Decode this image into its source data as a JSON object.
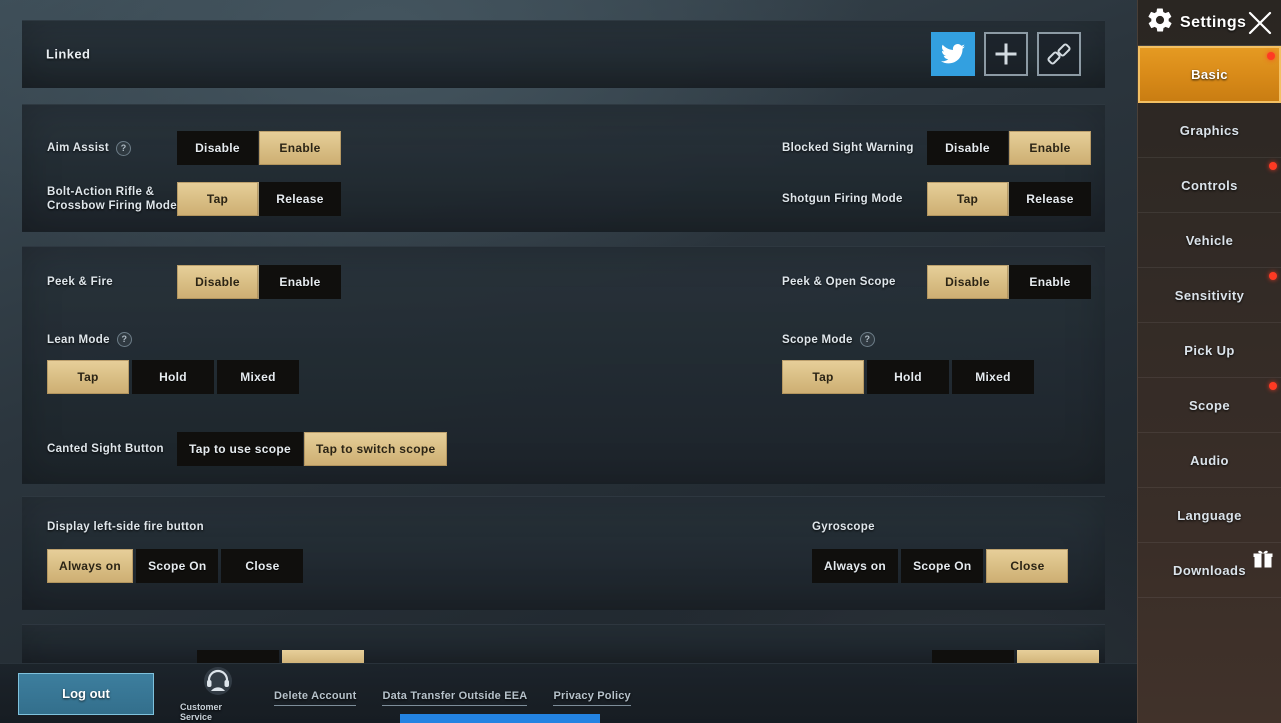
{
  "sidebar": {
    "title": "Settings",
    "gear_icon": "gear-icon",
    "close_icon": "close-icon",
    "items": [
      {
        "label": "Basic",
        "active": true,
        "badge": true,
        "gift": false
      },
      {
        "label": "Graphics",
        "active": false,
        "badge": false,
        "gift": false
      },
      {
        "label": "Controls",
        "active": false,
        "badge": true,
        "gift": false
      },
      {
        "label": "Vehicle",
        "active": false,
        "badge": false,
        "gift": false
      },
      {
        "label": "Sensitivity",
        "active": false,
        "badge": true,
        "gift": false
      },
      {
        "label": "Pick Up",
        "active": false,
        "badge": false,
        "gift": false
      },
      {
        "label": "Scope",
        "active": false,
        "badge": true,
        "gift": false
      },
      {
        "label": "Audio",
        "active": false,
        "badge": false,
        "gift": false
      },
      {
        "label": "Language",
        "active": false,
        "badge": false,
        "gift": false
      },
      {
        "label": "Downloads",
        "active": false,
        "badge": false,
        "gift": true
      }
    ]
  },
  "linked": {
    "label": "Linked",
    "icons": [
      {
        "name": "twitter-icon",
        "style": "twitter"
      },
      {
        "name": "plus-icon",
        "style": "outline"
      },
      {
        "name": "unlink-icon",
        "style": "outline"
      }
    ]
  },
  "settings": {
    "aim_assist": {
      "label": "Aim Assist",
      "help": true,
      "options": [
        "Disable",
        "Enable"
      ],
      "selected": "Enable"
    },
    "blocked_sight": {
      "label": "Blocked Sight Warning",
      "help": false,
      "options": [
        "Disable",
        "Enable"
      ],
      "selected": "Enable"
    },
    "bolt_action": {
      "label_line1": "Bolt-Action Rifle &",
      "label_line2": "Crossbow Firing Mode",
      "options": [
        "Tap",
        "Release"
      ],
      "selected": "Tap"
    },
    "shotgun_firing": {
      "label": "Shotgun Firing Mode",
      "options": [
        "Tap",
        "Release"
      ],
      "selected": "Tap"
    },
    "peek_fire": {
      "label": "Peek & Fire",
      "options": [
        "Disable",
        "Enable"
      ],
      "selected": "Disable"
    },
    "peek_open_scope": {
      "label": "Peek & Open Scope",
      "options": [
        "Disable",
        "Enable"
      ],
      "selected": "Disable"
    },
    "lean_mode": {
      "label": "Lean Mode",
      "help": true,
      "options": [
        "Tap",
        "Hold",
        "Mixed"
      ],
      "selected": "Tap"
    },
    "scope_mode": {
      "label": "Scope Mode",
      "help": true,
      "options": [
        "Tap",
        "Hold",
        "Mixed"
      ],
      "selected": "Tap"
    },
    "canted_sight": {
      "label": "Canted Sight Button",
      "options": [
        "Tap to use scope",
        "Tap to switch scope"
      ],
      "selected": "Tap to switch scope",
      "badge_on_selected": true
    },
    "left_fire_button": {
      "label": "Display left-side fire button",
      "options": [
        "Always on",
        "Scope On",
        "Close"
      ],
      "selected": "Always on"
    },
    "gyroscope": {
      "label": "Gyroscope",
      "options": [
        "Always on",
        "Scope On",
        "Close"
      ],
      "selected": "Close"
    }
  },
  "bottom": {
    "logout_label": "Log out",
    "customer_service_label": "Customer Service",
    "customer_service_icon": "headset-icon",
    "links": [
      "Delete Account",
      "Data Transfer Outside EEA",
      "Privacy Policy"
    ]
  },
  "colors": {
    "accent_gold": "#d8bd83",
    "accent_orange": "#d98b19",
    "badge_red": "#ef2b1c",
    "twitter_blue": "#33a0e0",
    "logout_blue": "#3d7e9e",
    "panel_bg": "#232c33"
  }
}
